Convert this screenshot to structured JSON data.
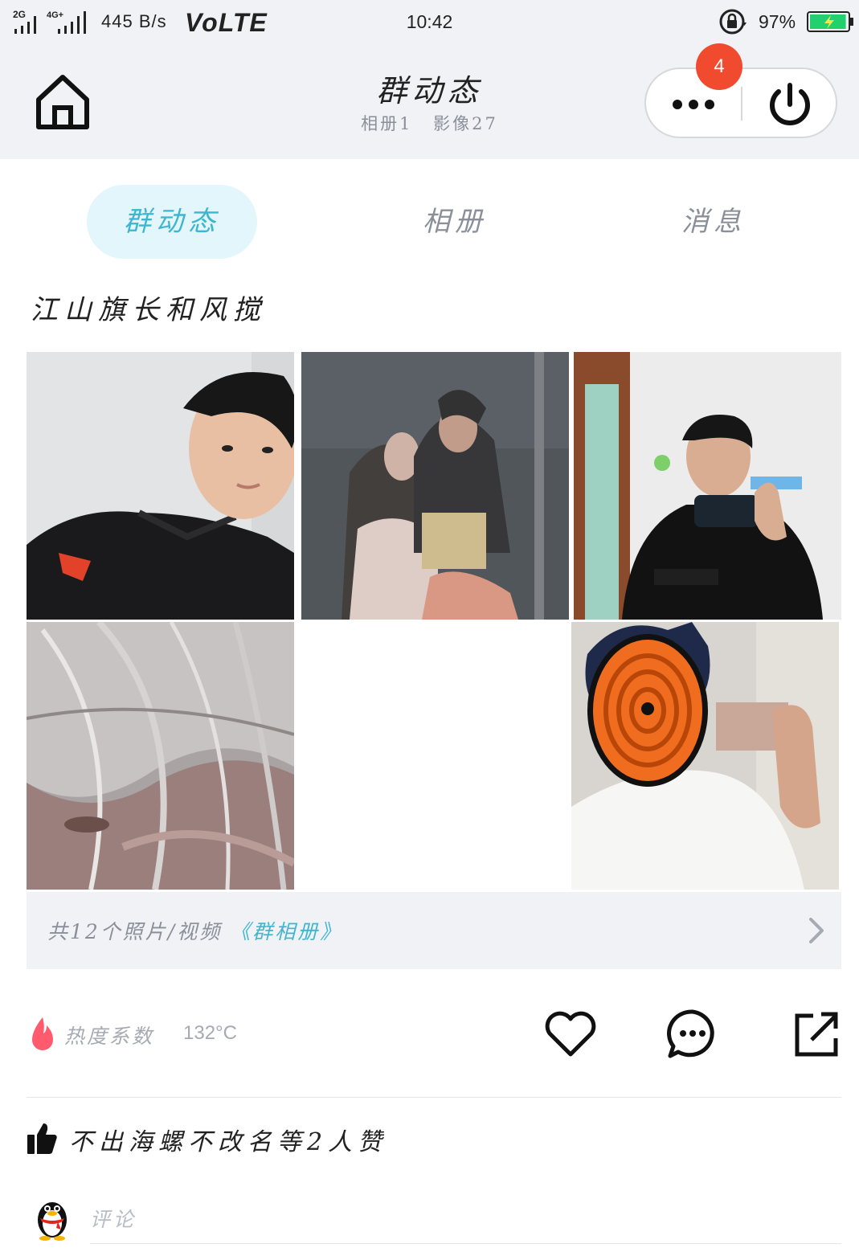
{
  "status_bar": {
    "network": "2G 4G",
    "speed": "445 B/s",
    "volte": "VoLTE",
    "time": "10:42",
    "battery_percent": "97%",
    "battery_level": 0.97,
    "battery_color": "#22d06e"
  },
  "header": {
    "title": "群动态",
    "albums": "相册1",
    "media": "影像27",
    "badge_count": "4",
    "icons": {
      "home": "home-icon",
      "more": "more-dots-icon",
      "power": "power-icon"
    }
  },
  "tabs": [
    {
      "label": "群动态",
      "active": true
    },
    {
      "label": "相册",
      "active": false
    },
    {
      "label": "消息",
      "active": false
    }
  ],
  "post": {
    "author": "江山旗长和风搅",
    "photos": [
      "photo-1",
      "photo-2",
      "photo-3",
      "photo-4",
      "photo-6"
    ],
    "album_summary": "共12个照片/视频",
    "album_link": "《群相册》",
    "heat_label": "热度系数",
    "heat_value": "132°C",
    "likes_text": "不出海螺不改名等2人赞",
    "comment_placeholder": "评论"
  },
  "colors": {
    "accent": "#3eb6cf",
    "accent_bg": "#e3f6fb",
    "badge": "#f04a2f",
    "header_bg": "#f1f2f5",
    "heat": "#ff5a6e"
  }
}
